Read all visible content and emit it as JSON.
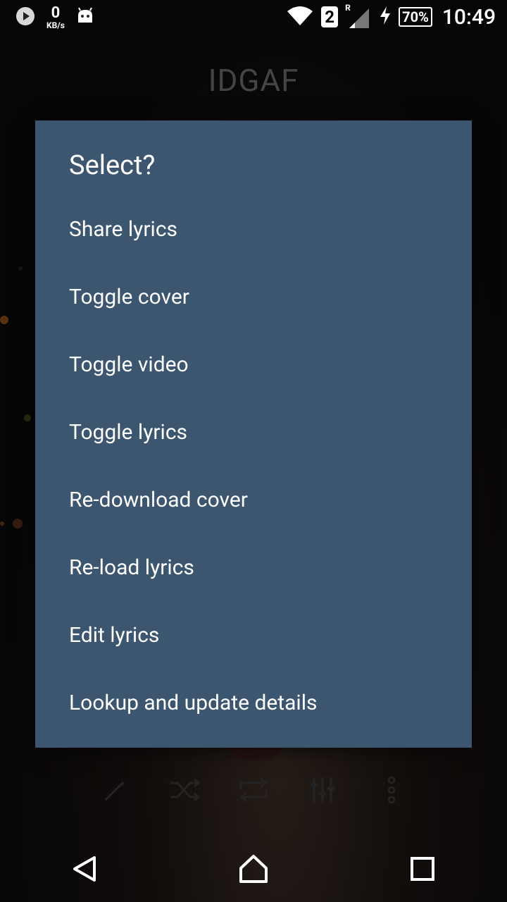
{
  "status_bar": {
    "net_speed_value": "0",
    "net_speed_unit": "KB/s",
    "sim_slot": "2",
    "roaming": "R",
    "battery": "70%",
    "time": "10:49",
    "icons": [
      "play-icon",
      "android-icon",
      "wifi-icon",
      "signal-icon",
      "charging-icon",
      "battery-icon"
    ]
  },
  "background": {
    "song_title": "IDGAF",
    "controls": [
      "magic-wand-icon",
      "shuffle-icon",
      "repeat-icon",
      "equalizer-icon",
      "more-vert-icon"
    ]
  },
  "dialog": {
    "title": "Select?",
    "items": [
      "Share lyrics",
      "Toggle cover",
      "Toggle video",
      "Toggle lyrics",
      "Re-download cover",
      "Re-load lyrics",
      "Edit lyrics",
      "Lookup and update details"
    ],
    "background_color": "#3c566f"
  },
  "nav_bar": {
    "buttons": [
      "back-icon",
      "home-icon",
      "recents-icon"
    ]
  }
}
